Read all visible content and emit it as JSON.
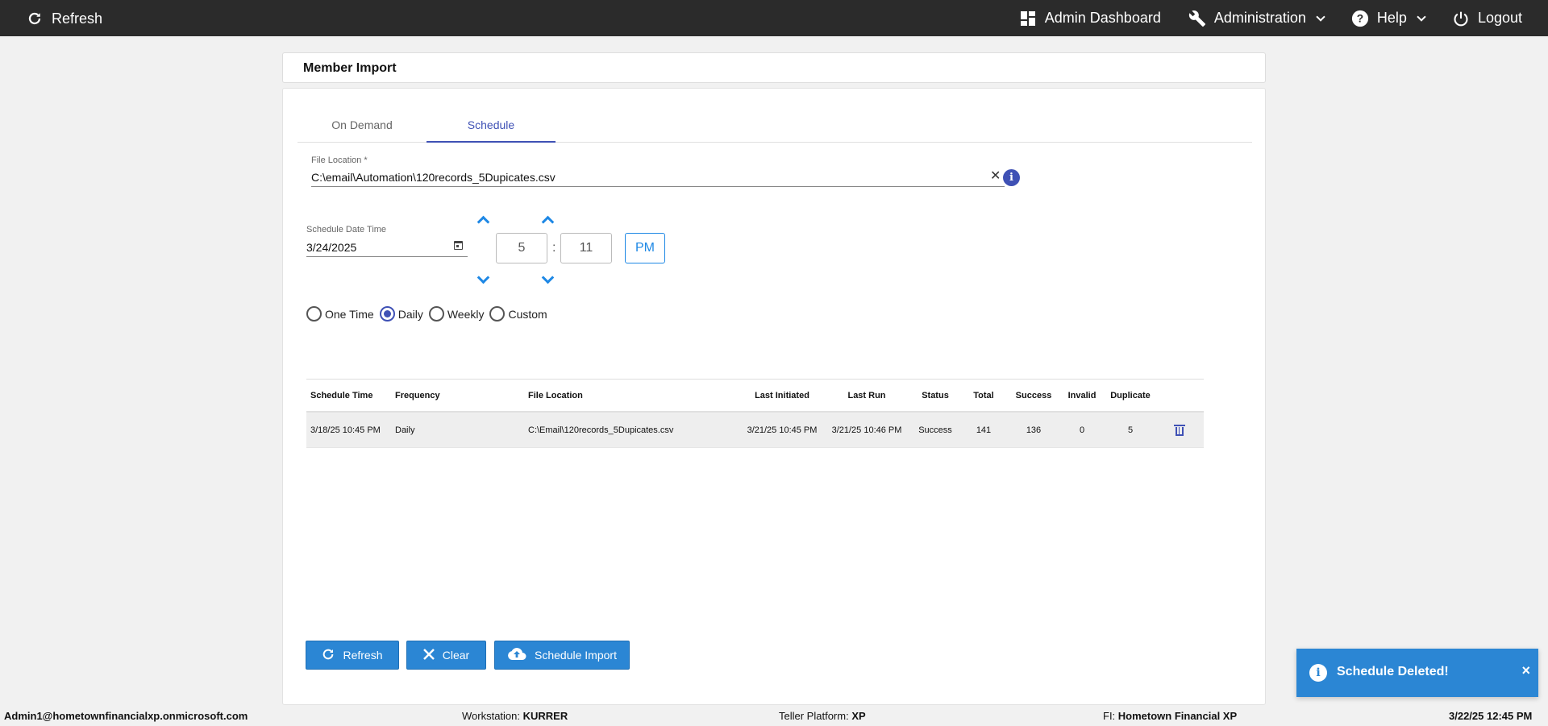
{
  "topbar": {
    "refresh_label": "Refresh",
    "admin_dashboard_label": "Admin Dashboard",
    "administration_label": "Administration",
    "help_label": "Help",
    "logout_label": "Logout"
  },
  "page_title": "Member Import",
  "tabs": [
    {
      "label": "On Demand",
      "active": false
    },
    {
      "label": "Schedule",
      "active": true
    }
  ],
  "file_location": {
    "label": "File Location *",
    "value": "C:\\email\\Automation\\120records_5Dupicates.csv"
  },
  "schedule_datetime": {
    "label": "Schedule Date Time",
    "date": "3/24/2025",
    "hour": "5",
    "minute": "11",
    "separator": ":",
    "ampm": "PM"
  },
  "frequency": {
    "options": [
      "One Time",
      "Daily",
      "Weekly",
      "Custom"
    ],
    "selected": "Daily"
  },
  "table": {
    "columns": [
      "Schedule Time",
      "Frequency",
      "File Location",
      "Last Initiated",
      "Last Run",
      "Status",
      "Total",
      "Success",
      "Invalid",
      "Duplicate"
    ],
    "rows": [
      {
        "schedule_time": "3/18/25 10:45 PM",
        "frequency": "Daily",
        "file_location": "C:\\Email\\120records_5Dupicates.csv",
        "last_initiated": "3/21/25 10:45 PM",
        "last_run": "3/21/25 10:46 PM",
        "status": "Success",
        "total": "141",
        "success": "136",
        "invalid": "0",
        "duplicate": "5"
      }
    ]
  },
  "buttons": {
    "refresh": "Refresh",
    "clear": "Clear",
    "schedule_import": "Schedule Import"
  },
  "footer": {
    "user": "Admin1@hometownfinancialxp.onmicrosoft.com",
    "workstation_label": "Workstation: ",
    "workstation": "KURRER",
    "platform_label": "Teller Platform: ",
    "platform": "XP",
    "fi_label": "FI: ",
    "fi": "Hometown Financial XP",
    "datetime": "3/22/25 12:45 PM"
  },
  "toast": {
    "message": "Schedule Deleted!",
    "close": "×"
  },
  "colors": {
    "topbar": "#2b2b2b",
    "accent": "#3f51b5",
    "button_blue": "#2b86d4"
  }
}
